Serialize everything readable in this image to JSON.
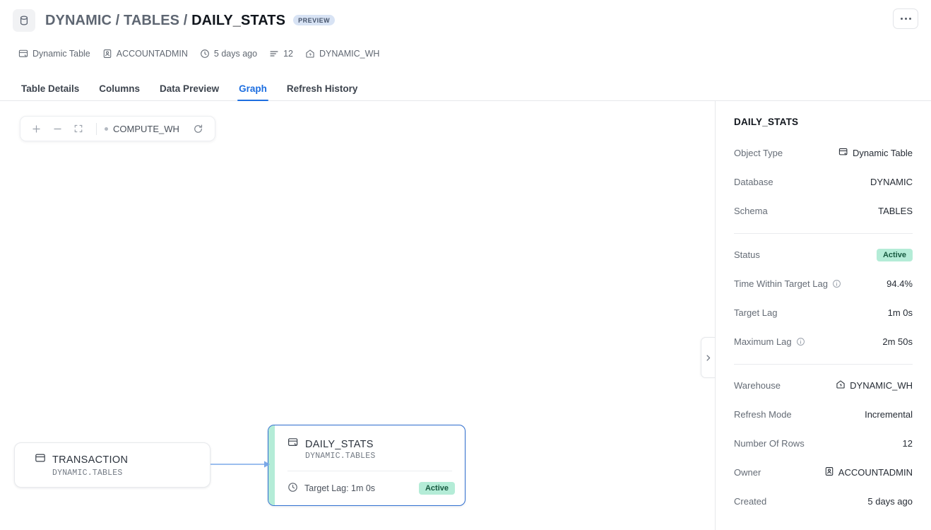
{
  "header": {
    "object_icon": "database-icon",
    "breadcrumb_prefix": "DYNAMIC / TABLES / ",
    "breadcrumb_leaf": "DAILY_STATS",
    "preview_badge": "PREVIEW",
    "kebab_label": "More actions"
  },
  "meta": [
    {
      "icon": "dynamic-table-icon",
      "label": "Dynamic Table"
    },
    {
      "icon": "user-badge-icon",
      "label": "ACCOUNTADMIN"
    },
    {
      "icon": "clock-icon",
      "label": "5 days ago"
    },
    {
      "icon": "rows-icon",
      "label": "12"
    },
    {
      "icon": "warehouse-icon",
      "label": "DYNAMIC_WH"
    }
  ],
  "tabs": [
    {
      "label": "Table Details",
      "active": false
    },
    {
      "label": "Columns",
      "active": false
    },
    {
      "label": "Data Preview",
      "active": false
    },
    {
      "label": "Graph",
      "active": true
    },
    {
      "label": "Refresh History",
      "active": false
    }
  ],
  "graph": {
    "toolbar": {
      "zoom_in": "+",
      "zoom_out": "−",
      "fit_view": "fit-screen-icon",
      "warehouse_label": "COMPUTE_WH",
      "refresh": "refresh-icon"
    },
    "nodes": [
      {
        "id": "source",
        "icon": "table-icon",
        "title": "TRANSACTION",
        "subtitle": "DYNAMIC.TABLES"
      },
      {
        "id": "selected",
        "icon": "dynamic-table-icon",
        "title": "DAILY_STATS",
        "subtitle": "DYNAMIC.TABLES",
        "lag_label": "Target Lag: 1m 0s",
        "status": "Active",
        "stripe_color": "#b4ecd7",
        "border_color": "#2f6fd0"
      }
    ],
    "edge_color": "#7aa8e8",
    "collapse_handle": "chevron-right-icon"
  },
  "panel": {
    "title": "DAILY_STATS",
    "groups": [
      {
        "rows": [
          {
            "label": "Object Type",
            "value": "Dynamic Table",
            "icon": "dynamic-table-icon",
            "info": false,
            "badge": false
          },
          {
            "label": "Database",
            "value": "DYNAMIC",
            "icon": "",
            "info": false,
            "badge": false
          },
          {
            "label": "Schema",
            "value": "TABLES",
            "icon": "",
            "info": false,
            "badge": false
          }
        ]
      },
      {
        "rows": [
          {
            "label": "Status",
            "value": "Active",
            "icon": "",
            "info": false,
            "badge": true
          },
          {
            "label": "Time Within Target Lag",
            "value": "94.4%",
            "icon": "",
            "info": true,
            "badge": false
          },
          {
            "label": "Target Lag",
            "value": "1m 0s",
            "icon": "",
            "info": false,
            "badge": false
          },
          {
            "label": "Maximum Lag",
            "value": "2m 50s",
            "icon": "",
            "info": true,
            "badge": false
          }
        ]
      },
      {
        "rows": [
          {
            "label": "Warehouse",
            "value": "DYNAMIC_WH",
            "icon": "warehouse-icon",
            "info": false,
            "badge": false
          },
          {
            "label": "Refresh Mode",
            "value": "Incremental",
            "icon": "",
            "info": false,
            "badge": false
          },
          {
            "label": "Number Of Rows",
            "value": "12",
            "icon": "",
            "info": false,
            "badge": false
          },
          {
            "label": "Owner",
            "value": "ACCOUNTADMIN",
            "icon": "user-badge-icon",
            "info": false,
            "badge": false
          },
          {
            "label": "Created",
            "value": "5 days ago",
            "icon": "",
            "info": false,
            "badge": false
          }
        ]
      }
    ]
  },
  "colors": {
    "accent": "#1d6ee0",
    "active_badge_bg": "#b4ecd7",
    "active_badge_text": "#16593f",
    "preview_badge_bg": "#d8e3f4",
    "edge": "#7aa8e8"
  }
}
